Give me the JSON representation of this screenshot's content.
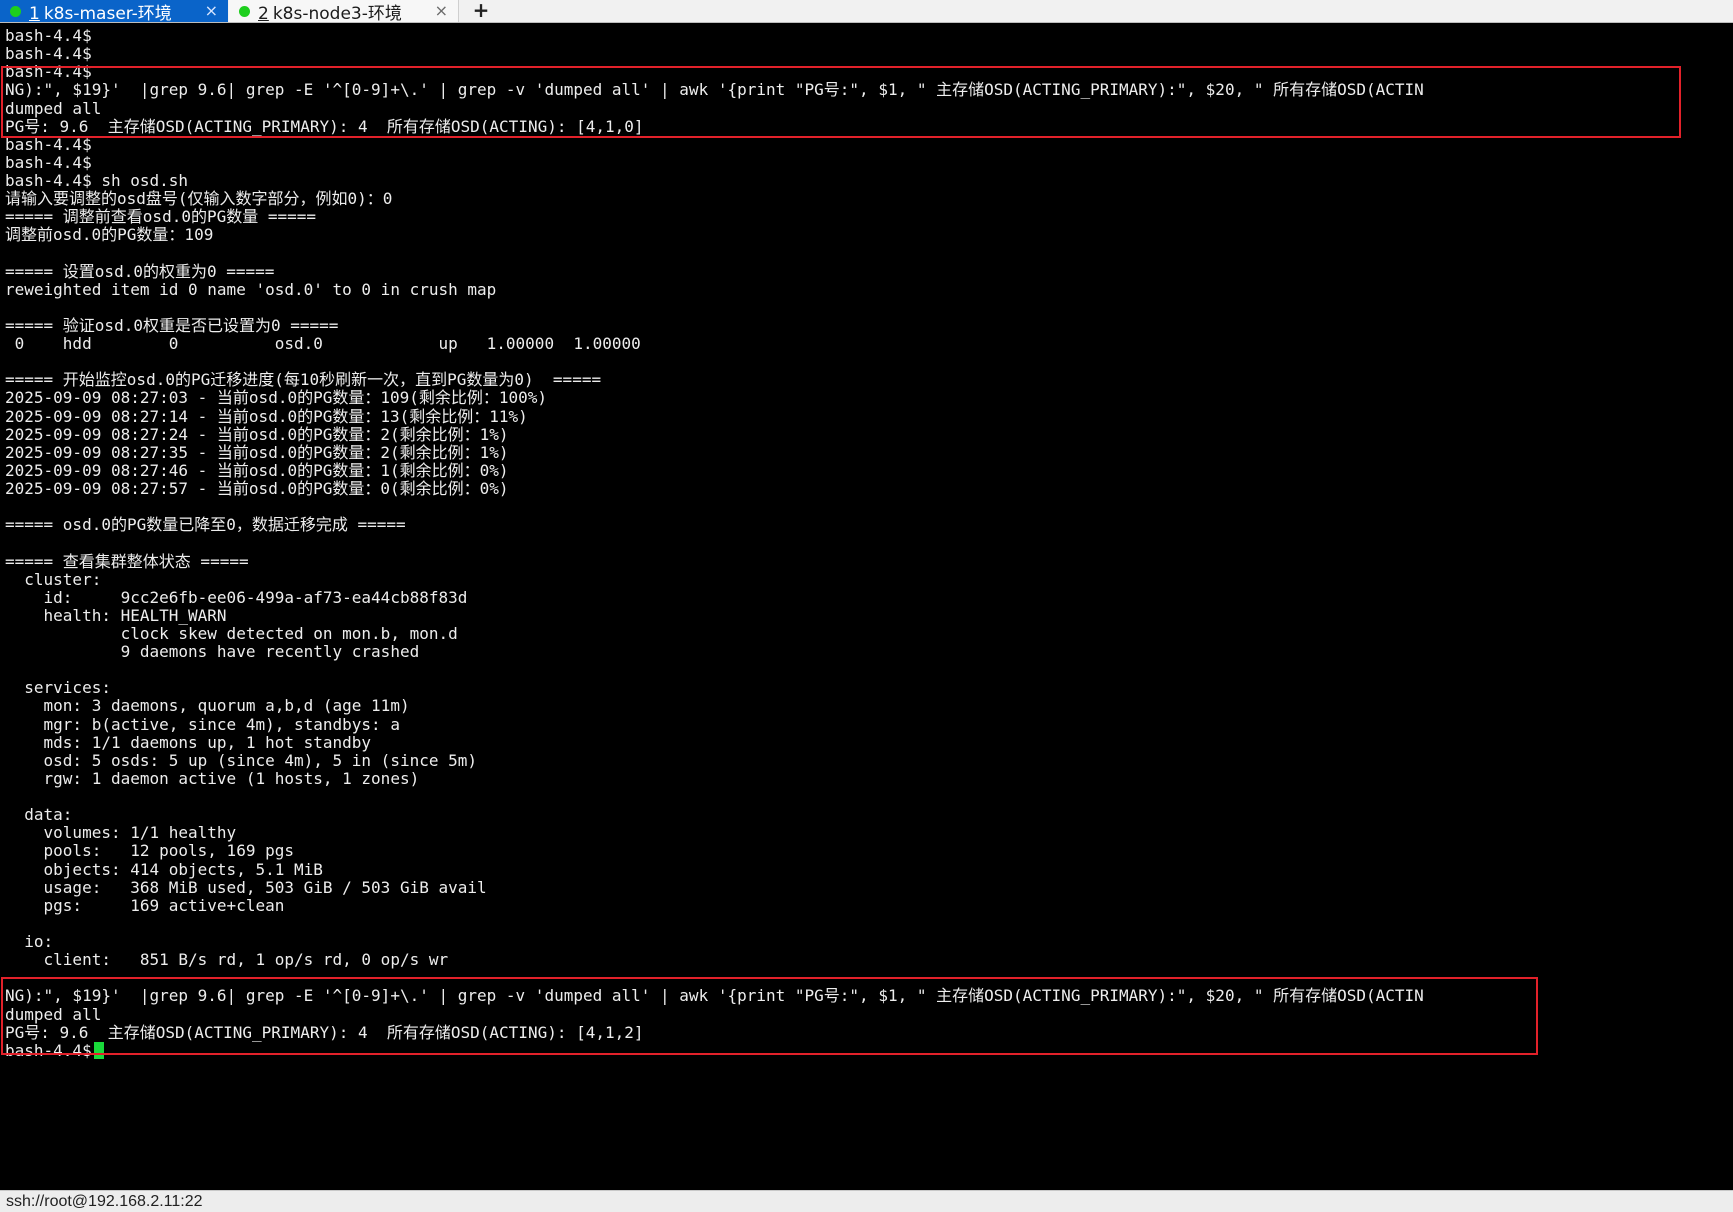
{
  "tabs": [
    {
      "num": "1",
      "title": "k8s-maser-环境",
      "close": "×",
      "status_color": "#1ecf1e"
    },
    {
      "num": "2",
      "title": "k8s-node3-环境",
      "close": "×",
      "status_color": "#1ecf1e"
    }
  ],
  "add_tab": "+",
  "terminal": {
    "lines": [
      "bash-4.4$",
      "bash-4.4$",
      "bash-4.4$",
      "NG):\", $19}'  |grep 9.6| grep -E '^[0-9]+\\.' | grep -v 'dumped all' | awk '{print \"PG号:\", $1, \" 主存储OSD(ACTING_PRIMARY):\", $20, \" 所有存储OSD(ACTIN",
      "dumped all",
      "PG号: 9.6  主存储OSD(ACTING_PRIMARY): 4  所有存储OSD(ACTING): [4,1,0]",
      "bash-4.4$",
      "bash-4.4$",
      "bash-4.4$ sh osd.sh",
      "请输入要调整的osd盘号(仅输入数字部分，例如0)：0",
      "===== 调整前查看osd.0的PG数量 =====",
      "调整前osd.0的PG数量：109",
      "",
      "===== 设置osd.0的权重为0 =====",
      "reweighted item id 0 name 'osd.0' to 0 in crush map",
      "",
      "===== 验证osd.0权重是否已设置为0 =====",
      " 0    hdd        0          osd.0            up   1.00000  1.00000",
      "",
      "===== 开始监控osd.0的PG迁移进度(每10秒刷新一次，直到PG数量为0)  =====",
      "2025-09-09 08:27:03 - 当前osd.0的PG数量：109(剩余比例：100%)",
      "2025-09-09 08:27:14 - 当前osd.0的PG数量：13(剩余比例：11%)",
      "2025-09-09 08:27:24 - 当前osd.0的PG数量：2(剩余比例：1%)",
      "2025-09-09 08:27:35 - 当前osd.0的PG数量：2(剩余比例：1%)",
      "2025-09-09 08:27:46 - 当前osd.0的PG数量：1(剩余比例：0%)",
      "2025-09-09 08:27:57 - 当前osd.0的PG数量：0(剩余比例：0%)",
      "",
      "===== osd.0的PG数量已降至0，数据迁移完成 =====",
      "",
      "===== 查看集群整体状态 =====",
      "  cluster:",
      "    id:     9cc2e6fb-ee06-499a-af73-ea44cb88f83d",
      "    health: HEALTH_WARN",
      "            clock skew detected on mon.b, mon.d",
      "            9 daemons have recently crashed",
      "",
      "  services:",
      "    mon: 3 daemons, quorum a,b,d (age 11m)",
      "    mgr: b(active, since 4m), standbys: a",
      "    mds: 1/1 daemons up, 1 hot standby",
      "    osd: 5 osds: 5 up (since 4m), 5 in (since 5m)",
      "    rgw: 1 daemon active (1 hosts, 1 zones)",
      "",
      "  data:",
      "    volumes: 1/1 healthy",
      "    pools:   12 pools, 169 pgs",
      "    objects: 414 objects, 5.1 MiB",
      "    usage:   368 MiB used, 503 GiB / 503 GiB avail",
      "    pgs:     169 active+clean",
      "",
      "  io:",
      "    client:   851 B/s rd, 1 op/s rd, 0 op/s wr",
      "",
      "NG):\", $19}'  |grep 9.6| grep -E '^[0-9]+\\.' | grep -v 'dumped all' | awk '{print \"PG号:\", $1, \" 主存储OSD(ACTING_PRIMARY):\", $20, \" 所有存储OSD(ACTIN",
      "dumped all",
      "PG号: 9.6  主存储OSD(ACTING_PRIMARY): 4  所有存储OSD(ACTING): [4,1,2]",
      "bash-4.4$"
    ],
    "cursor_color": "#19d93a",
    "highlight_color": "#e2212a"
  },
  "status": {
    "connection": "ssh://root@192.168.2.11:22"
  }
}
